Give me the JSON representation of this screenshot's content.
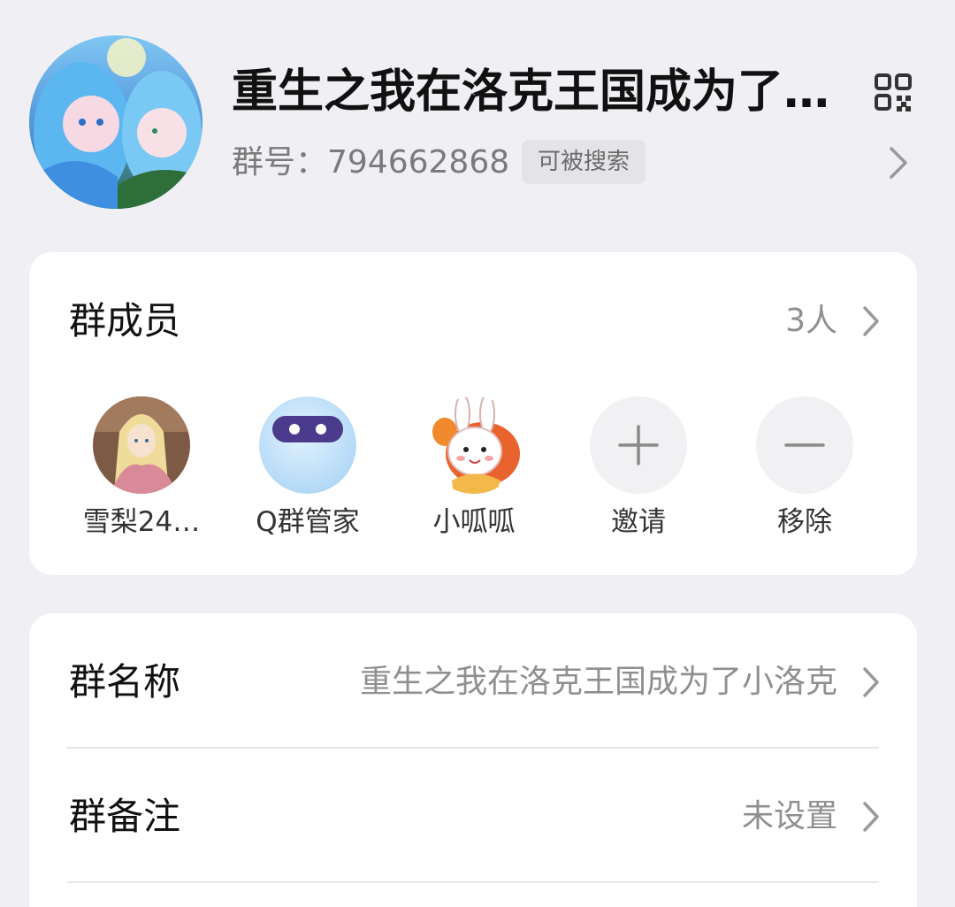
{
  "header": {
    "title": "重生之我在洛克王国成为了…",
    "group_number": "群号：794662868",
    "searchable_badge": "可被搜索"
  },
  "members_section": {
    "title": "群成员",
    "count": "3人",
    "members": [
      {
        "name": "雪梨24…"
      },
      {
        "name": "Q群管家"
      },
      {
        "name": "小呱呱"
      }
    ],
    "invite_label": "邀请",
    "remove_label": "移除"
  },
  "settings": {
    "group_name": {
      "label": "群名称",
      "value": "重生之我在洛克王国成为了小洛克"
    },
    "group_remark": {
      "label": "群备注",
      "value": "未设置"
    }
  },
  "colors": {
    "background": "#efeff4",
    "card": "#ffffff",
    "secondary_text": "#8f8f8f"
  }
}
